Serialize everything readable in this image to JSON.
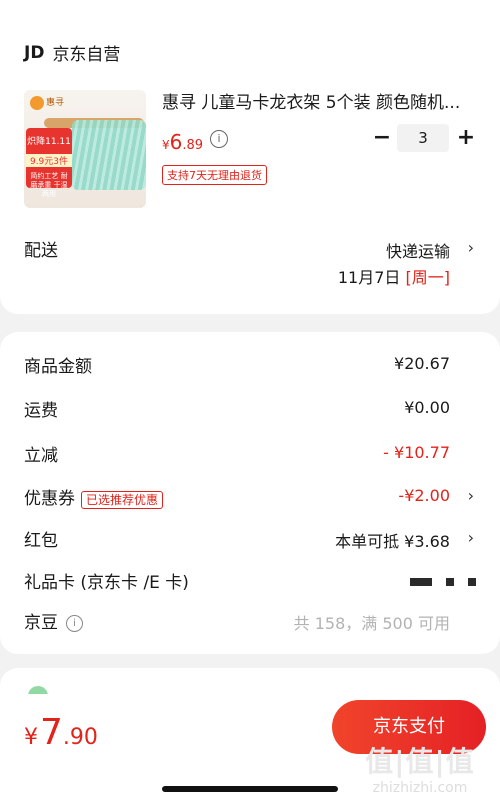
{
  "store": {
    "logo": "JD",
    "name": "京东自营"
  },
  "product": {
    "title": "惠寻 儿童马卡龙衣架 5个装 颜色随机...",
    "price_yen": "¥",
    "price_int": "6",
    "price_dec": ".89",
    "return_tag": "支持7天无理由退货",
    "quantity": "3",
    "thumb": {
      "brand": "惠寻",
      "promo_line1": "炽降11.11",
      "promo_line2": "9.9元3件",
      "promo_line3": "简约工艺 耐磨承重 干湿两用"
    }
  },
  "delivery": {
    "label": "配送",
    "method": "快递运输",
    "date": "11月7日",
    "weekday": "[周一]"
  },
  "summary": {
    "goods_label": "商品金额",
    "goods_value": "¥20.67",
    "shipping_label": "运费",
    "shipping_value": "¥0.00",
    "discount_label": "立减",
    "discount_value": "- ¥10.77",
    "coupon_label": "优惠券",
    "coupon_tag": "已选推荐优惠",
    "coupon_value": "-¥2.00",
    "redpacket_label": "红包",
    "redpacket_value": "本单可抵 ¥3.68",
    "giftcard_label": "礼品卡 (京东卡 /E 卡)",
    "beans_label": "京豆",
    "beans_value": "共 158，满 500 可用"
  },
  "footer": {
    "total_yen": "¥",
    "total_int": "7",
    "total_dec": ".90",
    "pay_label": "京东支付",
    "watermark": "值|值|值",
    "watermark_url": "zhizhizhi.com"
  },
  "colors": {
    "accent": "#e2231a",
    "background": "#f2f2f2"
  }
}
